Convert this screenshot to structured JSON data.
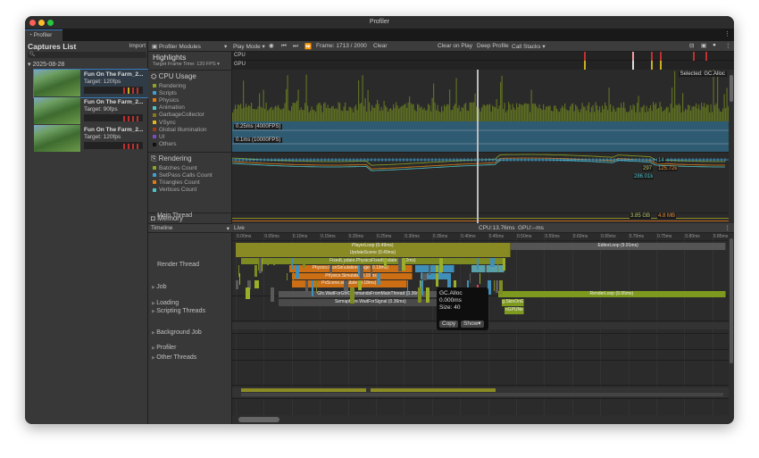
{
  "window": {
    "title": "Profiler",
    "tab": "Profiler"
  },
  "captures": {
    "title": "Captures List",
    "import": "Import",
    "date": "2025-08-28",
    "items": [
      {
        "name": "Fun On The Farm_2...",
        "target": "Target: 120fps",
        "selected": true
      },
      {
        "name": "Fun On The Farm_2...",
        "target": "Target: 90fps",
        "selected": false
      },
      {
        "name": "Fun On The Farm_2...",
        "target": "Target: 120fps",
        "selected": false
      }
    ]
  },
  "toolbar": {
    "modules": "Profiler Modules",
    "play_mode": "Play Mode",
    "frame": "Frame: 1713 / 2000",
    "clear": "Clear",
    "clear_on_play": "Clear on Play",
    "deep_profile": "Deep Profile",
    "call_stacks": "Call Stacks"
  },
  "highlights": {
    "title": "Highlights",
    "target_frame": "Target Frame Time: 120 FPS",
    "cpu": "CPU",
    "gpu": "GPU",
    "selected": "Selected: GC.Alloc"
  },
  "cpu_module": {
    "title": "CPU Usage",
    "legend": [
      {
        "name": "Rendering",
        "color": "#8aa524"
      },
      {
        "name": "Scripts",
        "color": "#3f9fd2"
      },
      {
        "name": "Physics",
        "color": "#e07b12"
      },
      {
        "name": "Animation",
        "color": "#4cc3c9"
      },
      {
        "name": "GarbageCollector",
        "color": "#877a1e"
      },
      {
        "name": "VSync",
        "color": "#e0b51d"
      },
      {
        "name": "Global Illumination",
        "color": "#a03a16"
      },
      {
        "name": "UI",
        "color": "#7a4bc4"
      },
      {
        "name": "Others",
        "color": "#111111"
      }
    ],
    "line1": "0.25ms (4000FPS)",
    "line2": "0.1ms (10000FPS)"
  },
  "rendering_module": {
    "title": "Rendering",
    "legend": [
      {
        "name": "Batches Count",
        "color": "#8aa524"
      },
      {
        "name": "SetPass Calls Count",
        "color": "#3f9fd2"
      },
      {
        "name": "Triangles Count",
        "color": "#e07b12"
      },
      {
        "name": "Vertices Count",
        "color": "#4cc3c9"
      }
    ],
    "values": {
      "setpass": "14",
      "batches": "297",
      "triangles": "125.72k",
      "vertices": "286.01k"
    }
  },
  "memory_module": {
    "title": "Memory",
    "values": {
      "total": "3.85 GB",
      "gc": "4.8 MB"
    }
  },
  "timeline": {
    "view": "Timeline",
    "live": "Live",
    "cpu": "CPU:13.76ms",
    "gpu": "GPU:--ms",
    "ticks": [
      "0.00ms",
      "0.05ms",
      "0.10ms",
      "0.15ms",
      "0.20ms",
      "0.25ms",
      "0.30ms",
      "0.35ms",
      "0.40ms",
      "0.45ms",
      "0.50ms",
      "0.55ms",
      "0.60ms",
      "0.65ms",
      "0.70ms",
      "0.75ms",
      "0.80ms",
      "0.85ms"
    ],
    "threads": [
      "Main Thread",
      "Render Thread",
      "Job",
      "Loading",
      "Scripting Threads",
      "Background Job",
      "Profiler",
      "Other Threads"
    ],
    "samples": [
      {
        "label": "PlayerLoop (0.49ms)",
        "start": 0.0,
        "dur": 0.49,
        "depth": 0,
        "color": "#8a8a24"
      },
      {
        "label": "EditorLoop (9.91ms)",
        "start": 0.49,
        "dur": 0.385,
        "depth": 0,
        "color": "#555555"
      },
      {
        "label": "UpdateScene (0.49ms)",
        "start": 0.0,
        "dur": 0.49,
        "depth": 1,
        "color": "#8a8a24"
      },
      {
        "label": "FixedUpdate.PhysicsFixedUpdate (0.22ms)",
        "start": 0.01,
        "dur": 0.47,
        "depth": 2,
        "color": "#7e8a22"
      },
      {
        "label": "Physics.RunSimulationStage (0.19ms)",
        "start": 0.095,
        "dur": 0.22,
        "depth": 3,
        "color": "#cc6f14"
      },
      {
        "label": "Physics.Simulate (0.19ms)",
        "start": 0.1,
        "dur": 0.215,
        "depth": 4,
        "color": "#cc6f14"
      },
      {
        "label": "PxScene.simulate (0.18ms)",
        "start": 0.1,
        "dur": 0.205,
        "depth": 5,
        "color": "#cc6f14"
      },
      {
        "label": "",
        "start": 0.32,
        "dur": 0.07,
        "depth": 3,
        "color": "#3f8fb8"
      },
      {
        "label": "",
        "start": 0.33,
        "dur": 0.05,
        "depth": 4,
        "color": "#3f8fb8"
      },
      {
        "label": "",
        "start": 0.42,
        "dur": 0.06,
        "depth": 3,
        "color": "#5aa0a8"
      },
      {
        "label": "Gfx.WaitForGfxCommandsFromMainThread (0.36ms)",
        "start": 0.076,
        "dur": 0.33,
        "depth": 6.4,
        "color": "#555555"
      },
      {
        "label": "Semaphore.WaitForSignal (0.36ms)",
        "start": 0.076,
        "dur": 0.33,
        "depth": 7.5,
        "color": "#4a4a4a"
      },
      {
        "label": "RenderLoop (9.95ms)",
        "start": 0.468,
        "dur": 0.406,
        "depth": 6.4,
        "color": "#7e9a1e"
      },
      {
        "label": "g.SkinOnG",
        "start": 0.475,
        "dur": 0.04,
        "depth": 7.5,
        "color": "#7e9a1e"
      },
      {
        "label": "nGPUNe",
        "start": 0.48,
        "dur": 0.035,
        "depth": 8.6,
        "color": "#7e9a1e"
      }
    ]
  },
  "tooltip": {
    "name": "GC.Alloc",
    "time": "0.000ms",
    "size": "Size: 40",
    "copy": "Copy",
    "show": "Show"
  }
}
